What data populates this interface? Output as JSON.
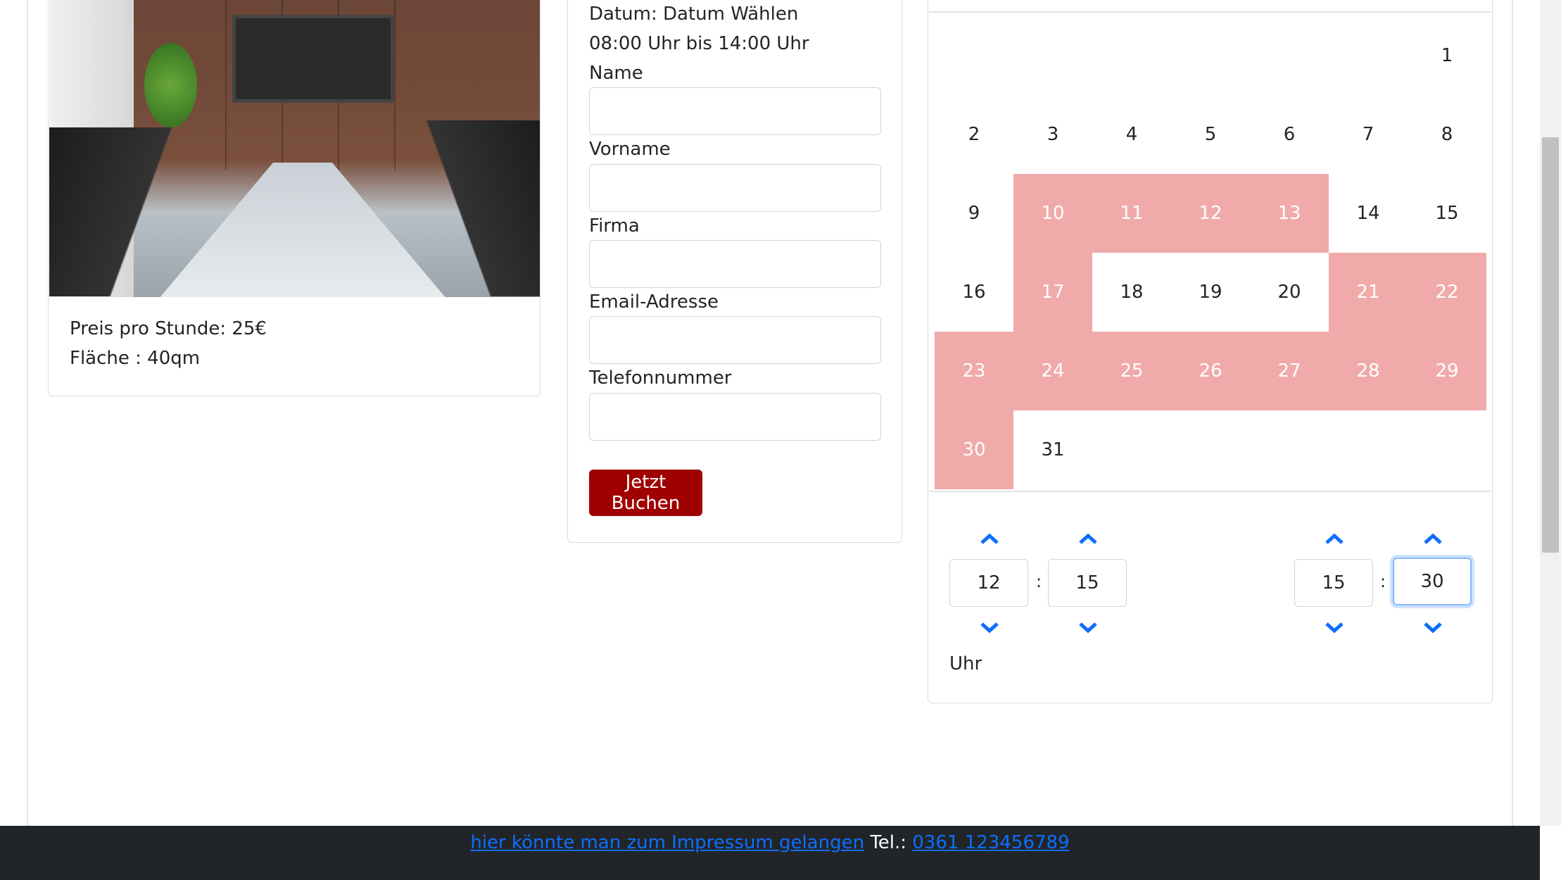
{
  "room": {
    "price": "Preis pro Stunde: 25€",
    "area": "Fläche : 40qm"
  },
  "form": {
    "date": "Datum: Datum Wählen",
    "time_range": "08:00 Uhr bis 14:00 Uhr",
    "name_label": "Name",
    "vorname_label": "Vorname",
    "firma_label": "Firma",
    "email_label": "Email-Adresse",
    "telefon_label": "Telefonnummer",
    "submit": "Jetzt Buchen"
  },
  "calendar": {
    "days": [
      "1",
      "2",
      "3",
      "4",
      "5",
      "6",
      "7",
      "8",
      "9",
      "10",
      "11",
      "12",
      "13",
      "14",
      "15",
      "16",
      "17",
      "18",
      "19",
      "20",
      "21",
      "22",
      "23",
      "24",
      "25",
      "26",
      "27",
      "28",
      "29",
      "30",
      "31"
    ],
    "booked_days": [
      10,
      11,
      12,
      13,
      17,
      21,
      22,
      23,
      24,
      25,
      26,
      27,
      28,
      29,
      30
    ],
    "booked_color": "#f0aaaa"
  },
  "time_picker": {
    "start_hour": "12",
    "start_minute": "15",
    "end_hour": "15",
    "end_minute": "30",
    "separator": ":",
    "unit_label": "Uhr"
  },
  "footer": {
    "impressum_link": "hier könnte man zum Impressum gelangen",
    "tel_label": "Tel.:",
    "phone_link": "0361 123456789"
  },
  "colors": {
    "accent": "#0d6efd",
    "button": "#a00000",
    "footer_bg": "#212529"
  }
}
